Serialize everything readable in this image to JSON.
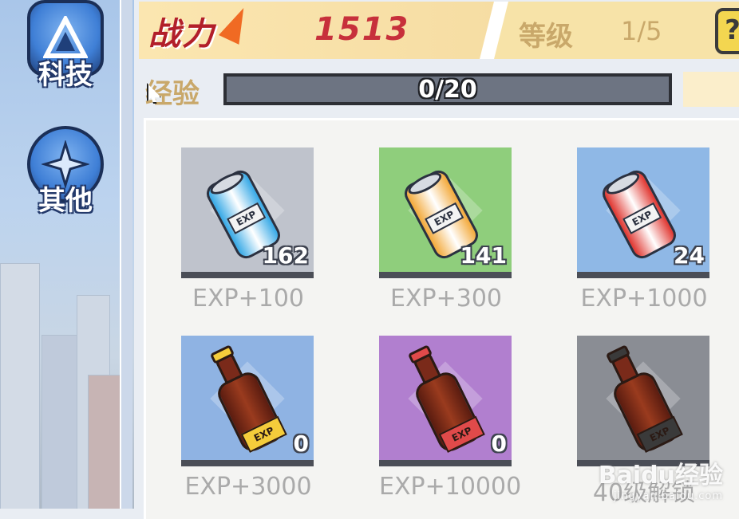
{
  "nav": {
    "tech_label": "科技",
    "other_label": "其他"
  },
  "header": {
    "combat_power_label": "战力",
    "combat_power_value": "1513",
    "level_label": "等级",
    "level_value": "1/5",
    "help_glyph": "?"
  },
  "experience": {
    "label": "经验",
    "progress_text": "0/20",
    "progress_fraction": 0
  },
  "items": [
    {
      "count": "162",
      "exp_text": "EXP+100",
      "kind": "can",
      "tile_color": "#bfc3cc",
      "item_color": "#35a8e6"
    },
    {
      "count": "141",
      "exp_text": "EXP+300",
      "kind": "can",
      "tile_color": "#8fce7c",
      "item_color": "#f3a93a"
    },
    {
      "count": "24",
      "exp_text": "EXP+1000",
      "kind": "can",
      "tile_color": "#8fb8e6",
      "item_color": "#e0352f"
    },
    {
      "count": "0",
      "exp_text": "EXP+3000",
      "kind": "bottle",
      "tile_color": "#8fb3e3",
      "item_color": "#f4cc3b"
    },
    {
      "count": "0",
      "exp_text": "EXP+10000",
      "kind": "bottle",
      "tile_color": "#b17fcf",
      "item_color": "#e04a4a"
    },
    {
      "count": "",
      "exp_text": "40级解锁",
      "kind": "bottle",
      "tile_color": "#8a8d94",
      "item_color": "#3a3a3a"
    }
  ],
  "can_tag_text": "EXP",
  "watermark": {
    "main": "Baidu经验",
    "sub": "jingyan.baidu.com"
  }
}
